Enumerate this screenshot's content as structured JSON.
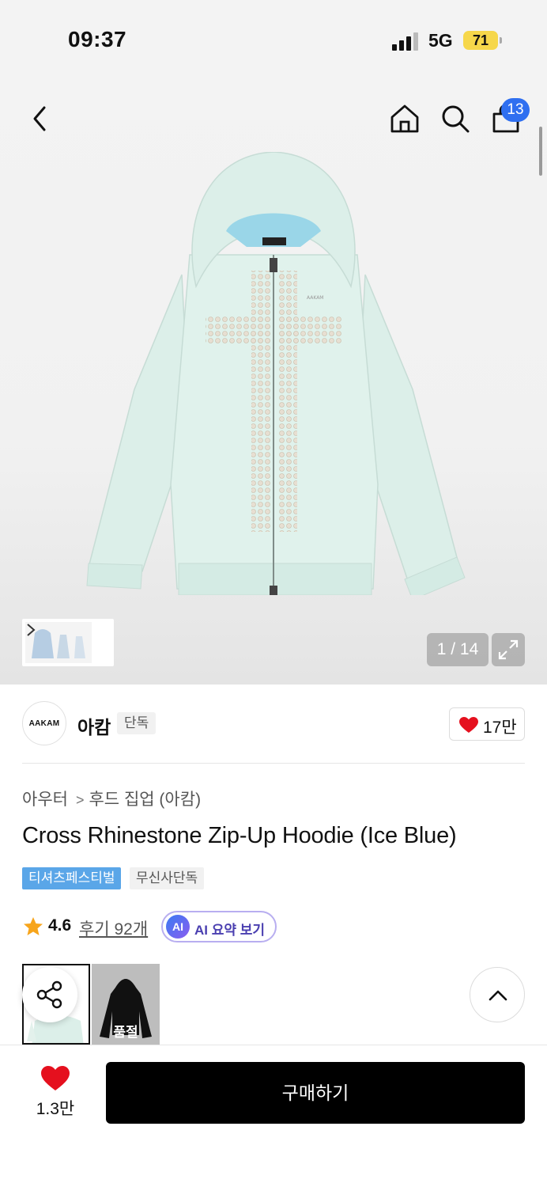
{
  "status_bar": {
    "time": "09:37",
    "network": "5G",
    "battery": "71"
  },
  "header": {
    "cart_count": "13"
  },
  "gallery": {
    "counter": "1 / 14"
  },
  "brand": {
    "logo_text": "AAKAM",
    "name": "아캄",
    "exclusive_tag": "단독",
    "like_count": "17만"
  },
  "breadcrumb": {
    "category": "아우터",
    "subcategory": "후드 집업 (아캄)"
  },
  "product": {
    "title": "Cross Rhinestone Zip-Up Hoodie (Ice Blue)",
    "tags": [
      "티셔츠페스티벌",
      "무신사단독"
    ],
    "rating": "4.6",
    "reviews": "후기 92개",
    "ai_badge": "AI",
    "ai_label": "AI 요약 보기"
  },
  "options": {
    "soldout_label": "품절"
  },
  "bottom_bar": {
    "wish_count": "1.3만",
    "buy_label": "구매하기"
  },
  "colors": {
    "accent_blue": "#2f6ff0",
    "heart_red": "#e5101e",
    "tag_blue": "#5aa6e8",
    "hoodie_ice_blue": "#dcefe9"
  },
  "icons": [
    "back-icon",
    "home-icon",
    "search-icon",
    "cart-icon",
    "chevron-right-icon",
    "expand-icon",
    "heart-icon",
    "star-icon",
    "share-icon",
    "chevron-up-icon"
  ]
}
